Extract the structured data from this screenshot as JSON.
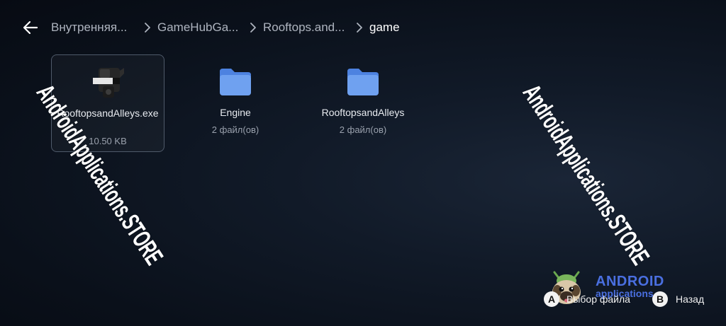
{
  "breadcrumb": {
    "items": [
      {
        "label": "Внутренняя..."
      },
      {
        "label": "GameHubGa..."
      },
      {
        "label": "Rooftops.and..."
      },
      {
        "label": "game"
      }
    ]
  },
  "files": [
    {
      "name": "RooftopsandAlleys.exe",
      "meta": "10.50 KB",
      "type": "executable",
      "icon": "game-exe-icon",
      "selected": true
    },
    {
      "name": "Engine",
      "meta": "2 файл(ов)",
      "type": "folder",
      "icon": "folder-icon"
    },
    {
      "name": "RooftopsandAlleys",
      "meta": "2 файл(ов)",
      "type": "folder",
      "icon": "folder-icon"
    }
  ],
  "watermarks": [
    "AndroidApplications.STORE",
    "AndroidApplications.STORE"
  ],
  "brand": {
    "title": "ANDROID",
    "subtitle": "applications"
  },
  "hints": [
    {
      "key": "A",
      "label": "Выбор файла"
    },
    {
      "key": "B",
      "label": "Назад"
    }
  ],
  "colors": {
    "folder": "#6fa1f0",
    "accent": "#4a6fe0",
    "background": "#0c1320"
  }
}
